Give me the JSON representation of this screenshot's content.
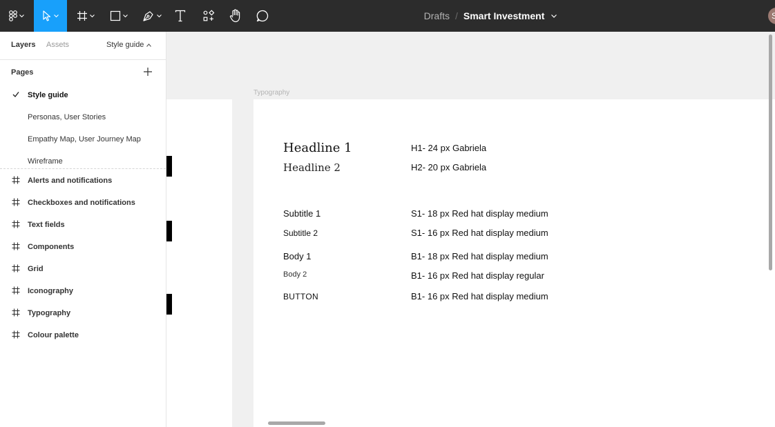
{
  "toolbar": {
    "main_menu_icon": "figma-logo-icon",
    "tools": [
      "move-icon",
      "frame-icon",
      "shape-icon",
      "pen-icon",
      "text-icon",
      "resources-icon",
      "hand-icon",
      "comment-icon"
    ],
    "breadcrumb_drafts": "Drafts",
    "breadcrumb_separator": "/",
    "file_name": "Smart Investment",
    "avatar_initial": "S",
    "accent_color": "#18a0fb",
    "background_color": "#2c2c2c"
  },
  "panel": {
    "tab_layers": "Layers",
    "tab_assets": "Assets",
    "style_guide_label": "Style guide",
    "pages_label": "Pages",
    "pages": [
      {
        "label": "Style guide",
        "current": true
      },
      {
        "label": "Personas, User Stories",
        "current": false
      },
      {
        "label": "Empathy Map, User Journey Map",
        "current": false
      },
      {
        "label": "Wireframe",
        "current": false
      }
    ],
    "frames": [
      "Alerts and notifications",
      "Checkboxes and notifications",
      "Text fields",
      "Components",
      "Grid",
      "Iconography",
      "Typography",
      "Colour palette"
    ]
  },
  "canvas": {
    "frame_label": "Typography",
    "rows": [
      {
        "name": "Headline 1",
        "spec": "H1- 24 px Gabriela"
      },
      {
        "name": "Headline 2",
        "spec": "H2- 20 px Gabriela"
      },
      {
        "name": "Subtitle 1",
        "spec": "S1- 18 px Red hat display medium"
      },
      {
        "name": "Subtitle 2",
        "spec": "S1- 16 px Red hat display medium"
      },
      {
        "name": "Body 1",
        "spec": "B1- 18 px Red hat display medium"
      },
      {
        "name": "Body 2",
        "spec": "B1- 16 px Red hat display regular"
      },
      {
        "name": "BUTTON",
        "spec": "B1- 16 px Red hat display medium"
      }
    ]
  }
}
